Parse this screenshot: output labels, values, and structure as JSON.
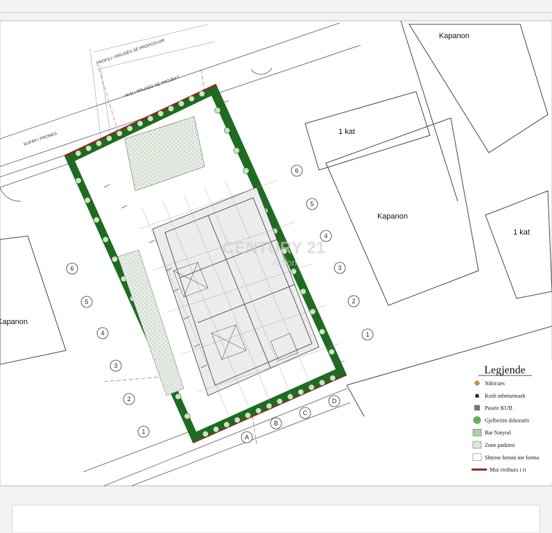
{
  "labels": {
    "kapanon_top_right": "Kapanon",
    "kat_mid": "1 kat",
    "kapanon_center_right": "Kapanon",
    "kat_right": "1 kat",
    "kapanon_left": "Kapanon",
    "road_profile": "PROFILI I RRUGËS SË PROPOZUAR",
    "road_axis": "AKSI I RRUGES NE PROJEKT",
    "kufiri_pronës": "KUFIRI I PRONES"
  },
  "grid": {
    "numbers_left": [
      "6",
      "5",
      "4",
      "3",
      "2",
      "1"
    ],
    "numbers_right": [
      "6",
      "5",
      "4",
      "3",
      "2",
      "1"
    ],
    "letters_bottom": [
      "A",
      "B",
      "C",
      "D"
    ]
  },
  "watermark": {
    "main": "CENTURY 21",
    "sub": "Action"
  },
  "legend": {
    "title": "Legjende",
    "items": [
      {
        "label": "Ndricues",
        "symbol": "lamp"
      },
      {
        "label": "Kosh mbeturinash",
        "symbol": "bin"
      },
      {
        "label": "Pusete KUB",
        "symbol": "manhole"
      },
      {
        "label": "Gjelberim dekorativ",
        "symbol": "shrub"
      },
      {
        "label": "Bar Natyral",
        "symbol": "grass"
      },
      {
        "label": "Zone parkimi",
        "symbol": "parking"
      },
      {
        "label": "Shtrese betoni me forma",
        "symbol": "concrete"
      },
      {
        "label": "Mur rrethues i ri",
        "symbol": "wall"
      }
    ]
  },
  "colors": {
    "green_border": "#1f6b22",
    "light_green": "#a9d3a0",
    "wall_red": "#8a2a1f",
    "line_gray": "#555555",
    "background": "#ffffff"
  }
}
